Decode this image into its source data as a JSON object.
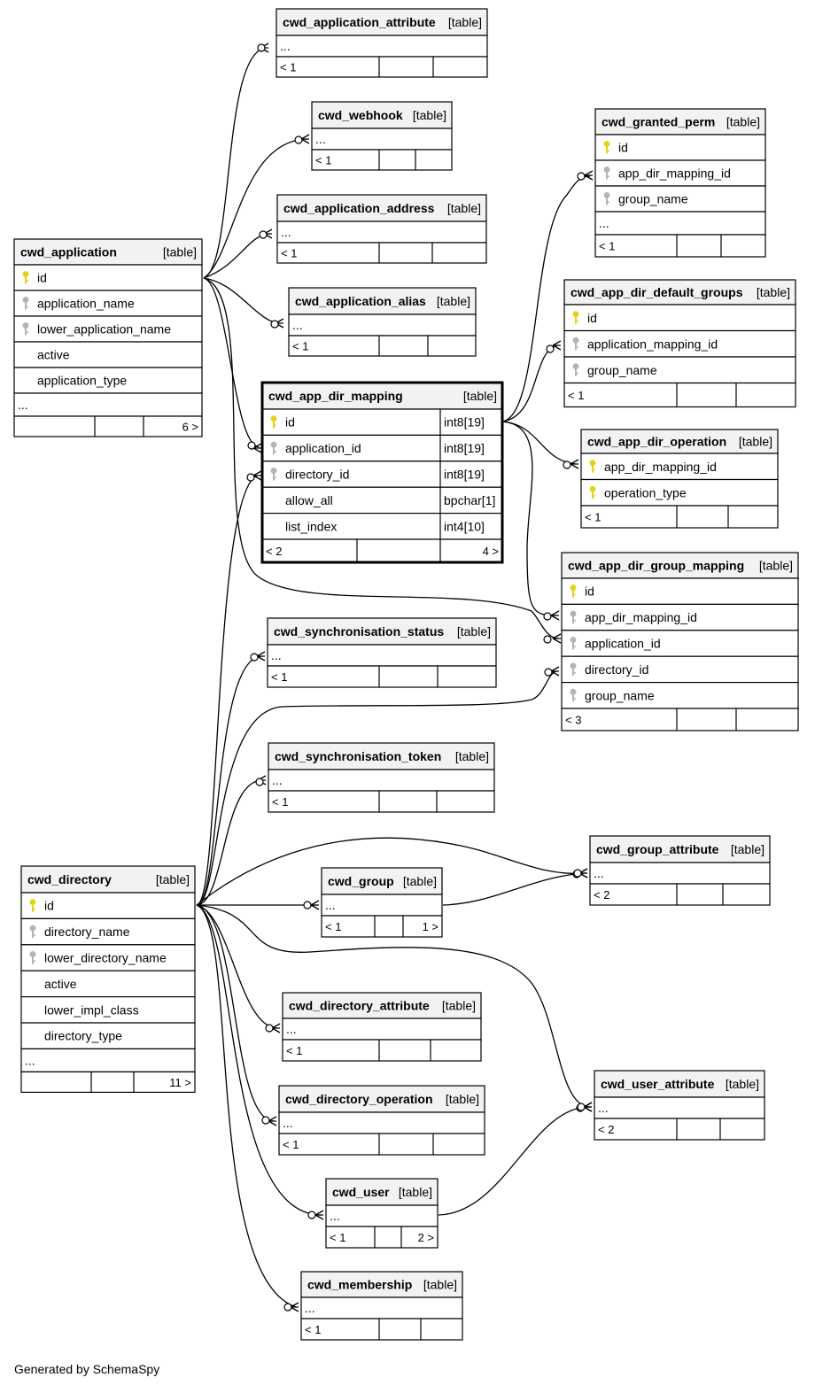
{
  "footer": "Generated by SchemaSpy",
  "key_colors": {
    "primary": "#e5d11a",
    "foreign": "#b3b3b3"
  },
  "tables": [
    {
      "id": "cwd_application_attribute",
      "name": "cwd_application_attribute",
      "tag": "[table]",
      "rows": [
        {
          "text": "..."
        }
      ],
      "footer": [
        "< 1",
        "",
        ""
      ]
    },
    {
      "id": "cwd_webhook",
      "name": "cwd_webhook",
      "tag": "[table]",
      "rows": [
        {
          "text": "..."
        }
      ],
      "footer": [
        "< 1",
        "",
        ""
      ]
    },
    {
      "id": "cwd_application_address",
      "name": "cwd_application_address",
      "tag": "[table]",
      "rows": [
        {
          "text": "..."
        }
      ],
      "footer": [
        "< 1",
        "",
        ""
      ]
    },
    {
      "id": "cwd_application_alias",
      "name": "cwd_application_alias",
      "tag": "[table]",
      "rows": [
        {
          "text": "..."
        }
      ],
      "footer": [
        "< 1",
        "",
        ""
      ]
    },
    {
      "id": "cwd_application",
      "name": "cwd_application",
      "tag": "[table]",
      "rows": [
        {
          "text": "id",
          "key": "primary"
        },
        {
          "text": "application_name",
          "key": "foreign"
        },
        {
          "text": "lower_application_name",
          "key": "foreign"
        },
        {
          "text": "active"
        },
        {
          "text": "application_type"
        },
        {
          "text": "..."
        }
      ],
      "footer": [
        "",
        "",
        "6 >"
      ]
    },
    {
      "id": "cwd_app_dir_mapping",
      "name": "cwd_app_dir_mapping",
      "tag": "[table]",
      "rows": [
        {
          "text": "id",
          "key": "primary",
          "type": "int8[19]"
        },
        {
          "text": "application_id",
          "key": "foreign",
          "type": "int8[19]"
        },
        {
          "text": "directory_id",
          "key": "foreign",
          "type": "int8[19]"
        },
        {
          "text": "allow_all",
          "type": "bpchar[1]"
        },
        {
          "text": "list_index",
          "type": "int4[10]"
        }
      ],
      "footer": [
        "< 2",
        "",
        "4 >"
      ]
    },
    {
      "id": "cwd_granted_perm",
      "name": "cwd_granted_perm",
      "tag": "[table]",
      "rows": [
        {
          "text": "id",
          "key": "primary"
        },
        {
          "text": "app_dir_mapping_id",
          "key": "foreign"
        },
        {
          "text": "group_name",
          "key": "foreign"
        },
        {
          "text": "..."
        }
      ],
      "footer": [
        "< 1",
        "",
        ""
      ]
    },
    {
      "id": "cwd_app_dir_default_groups",
      "name": "cwd_app_dir_default_groups",
      "tag": "[table]",
      "rows": [
        {
          "text": "id",
          "key": "primary"
        },
        {
          "text": "application_mapping_id",
          "key": "foreign"
        },
        {
          "text": "group_name",
          "key": "foreign"
        }
      ],
      "footer": [
        "< 1",
        "",
        ""
      ]
    },
    {
      "id": "cwd_app_dir_operation",
      "name": "cwd_app_dir_operation",
      "tag": "[table]",
      "rows": [
        {
          "text": "app_dir_mapping_id",
          "key": "primary"
        },
        {
          "text": "operation_type",
          "key": "primary"
        }
      ],
      "footer": [
        "< 1",
        "",
        ""
      ]
    },
    {
      "id": "cwd_app_dir_group_mapping",
      "name": "cwd_app_dir_group_mapping",
      "tag": "[table]",
      "rows": [
        {
          "text": "id",
          "key": "primary"
        },
        {
          "text": "app_dir_mapping_id",
          "key": "foreign"
        },
        {
          "text": "application_id",
          "key": "foreign"
        },
        {
          "text": "directory_id",
          "key": "foreign"
        },
        {
          "text": "group_name",
          "key": "foreign"
        }
      ],
      "footer": [
        "< 3",
        "",
        ""
      ]
    },
    {
      "id": "cwd_synchronisation_status",
      "name": "cwd_synchronisation_status",
      "tag": "[table]",
      "rows": [
        {
          "text": "..."
        }
      ],
      "footer": [
        "< 1",
        "",
        ""
      ]
    },
    {
      "id": "cwd_synchronisation_token",
      "name": "cwd_synchronisation_token",
      "tag": "[table]",
      "rows": [
        {
          "text": "..."
        }
      ],
      "footer": [
        "< 1",
        "",
        ""
      ]
    },
    {
      "id": "cwd_directory",
      "name": "cwd_directory",
      "tag": "[table]",
      "rows": [
        {
          "text": "id",
          "key": "primary"
        },
        {
          "text": "directory_name",
          "key": "foreign"
        },
        {
          "text": "lower_directory_name",
          "key": "foreign"
        },
        {
          "text": "active"
        },
        {
          "text": "lower_impl_class"
        },
        {
          "text": "directory_type"
        },
        {
          "text": "..."
        }
      ],
      "footer": [
        "",
        "",
        "11 >"
      ]
    },
    {
      "id": "cwd_group_attribute",
      "name": "cwd_group_attribute",
      "tag": "[table]",
      "rows": [
        {
          "text": "..."
        }
      ],
      "footer": [
        "< 2",
        "",
        ""
      ]
    },
    {
      "id": "cwd_group",
      "name": "cwd_group",
      "tag": "[table]",
      "rows": [
        {
          "text": "..."
        }
      ],
      "footer": [
        "< 1",
        "",
        "1 >"
      ]
    },
    {
      "id": "cwd_directory_attribute",
      "name": "cwd_directory_attribute",
      "tag": "[table]",
      "rows": [
        {
          "text": "..."
        }
      ],
      "footer": [
        "< 1",
        "",
        ""
      ]
    },
    {
      "id": "cwd_user_attribute",
      "name": "cwd_user_attribute",
      "tag": "[table]",
      "rows": [
        {
          "text": "..."
        }
      ],
      "footer": [
        "< 2",
        "",
        ""
      ]
    },
    {
      "id": "cwd_directory_operation",
      "name": "cwd_directory_operation",
      "tag": "[table]",
      "rows": [
        {
          "text": "..."
        }
      ],
      "footer": [
        "< 1",
        "",
        ""
      ]
    },
    {
      "id": "cwd_user",
      "name": "cwd_user",
      "tag": "[table]",
      "rows": [
        {
          "text": "..."
        }
      ],
      "footer": [
        "< 1",
        "",
        "2 >"
      ]
    },
    {
      "id": "cwd_membership",
      "name": "cwd_membership",
      "tag": "[table]",
      "rows": [
        {
          "text": "..."
        }
      ],
      "footer": [
        "< 1",
        "",
        ""
      ]
    }
  ],
  "relationships": [
    {
      "from": "cwd_application",
      "to": "cwd_application_attribute"
    },
    {
      "from": "cwd_application",
      "to": "cwd_webhook"
    },
    {
      "from": "cwd_application",
      "to": "cwd_application_address"
    },
    {
      "from": "cwd_application",
      "to": "cwd_application_alias"
    },
    {
      "from": "cwd_application",
      "to": "cwd_app_dir_mapping"
    },
    {
      "from": "cwd_application",
      "to": "cwd_app_dir_group_mapping"
    },
    {
      "from": "cwd_app_dir_mapping",
      "to": "cwd_granted_perm"
    },
    {
      "from": "cwd_app_dir_mapping",
      "to": "cwd_app_dir_default_groups"
    },
    {
      "from": "cwd_app_dir_mapping",
      "to": "cwd_app_dir_operation"
    },
    {
      "from": "cwd_app_dir_mapping",
      "to": "cwd_app_dir_group_mapping"
    },
    {
      "from": "cwd_directory",
      "to": "cwd_app_dir_mapping"
    },
    {
      "from": "cwd_directory",
      "to": "cwd_synchronisation_status"
    },
    {
      "from": "cwd_directory",
      "to": "cwd_app_dir_group_mapping"
    },
    {
      "from": "cwd_directory",
      "to": "cwd_synchronisation_token"
    },
    {
      "from": "cwd_directory",
      "to": "cwd_group_attribute"
    },
    {
      "from": "cwd_directory",
      "to": "cwd_group"
    },
    {
      "from": "cwd_group",
      "to": "cwd_group_attribute"
    },
    {
      "from": "cwd_directory",
      "to": "cwd_user_attribute"
    },
    {
      "from": "cwd_directory",
      "to": "cwd_directory_attribute"
    },
    {
      "from": "cwd_directory",
      "to": "cwd_directory_operation"
    },
    {
      "from": "cwd_directory",
      "to": "cwd_user"
    },
    {
      "from": "cwd_user",
      "to": "cwd_user_attribute"
    },
    {
      "from": "cwd_directory",
      "to": "cwd_membership"
    }
  ]
}
